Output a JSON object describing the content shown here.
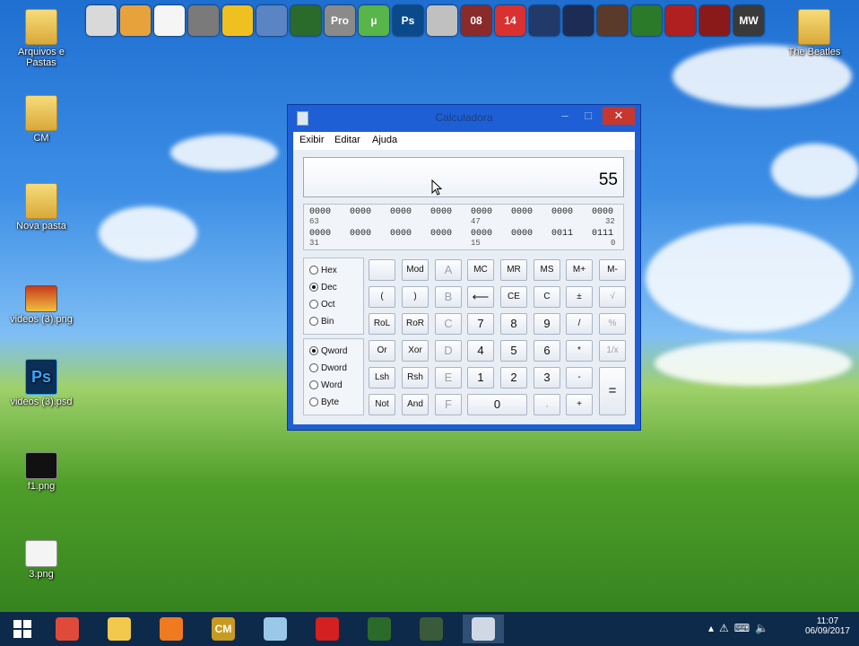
{
  "desktop": {
    "icons": [
      {
        "label": "Arquivos e Pastas"
      },
      {
        "label": "CM"
      },
      {
        "label": "Nova pasta"
      },
      {
        "label": "videos (3).png"
      },
      {
        "label": "videos (3).psd"
      },
      {
        "label": "f1.png"
      },
      {
        "label": "3.png"
      },
      {
        "label": "The Beatles"
      }
    ],
    "top_shortcuts": [
      {
        "text": "",
        "icon": "recycle-bin-icon",
        "color": "#d9d9d9"
      },
      {
        "text": "",
        "icon": "tools-icon",
        "color": "#e8a23c"
      },
      {
        "text": "",
        "icon": "notepad-icon",
        "color": "#f5f5f5"
      },
      {
        "text": "",
        "icon": "joystick-icon",
        "color": "#7a7a7a"
      },
      {
        "text": "",
        "icon": "network-icon",
        "color": "#f0c020"
      },
      {
        "text": "",
        "icon": "virtualbox-icon",
        "color": "#5a84c4"
      },
      {
        "text": "",
        "icon": "3ds-icon",
        "color": "#2a6a2a"
      },
      {
        "text": "Pro",
        "icon": "cd-pro-icon",
        "color": "#8a8a8a"
      },
      {
        "text": "µ",
        "icon": "utorrent-icon",
        "color": "#57b54a"
      },
      {
        "text": "Ps",
        "icon": "photoshop-icon",
        "color": "#0b4a8a"
      },
      {
        "text": "",
        "icon": "gamepad-icon",
        "color": "#c0c0c0"
      },
      {
        "text": "08",
        "icon": "game-08-icon",
        "color": "#8a2a2a"
      },
      {
        "text": "14",
        "icon": "game-14-icon",
        "color": "#d93030"
      },
      {
        "text": "",
        "icon": "pes-icon",
        "color": "#223a6a"
      },
      {
        "text": "",
        "icon": "pes-2-icon",
        "color": "#1c2c54"
      },
      {
        "text": "",
        "icon": "driver-icon",
        "color": "#5a3a2a"
      },
      {
        "text": "",
        "icon": "farming-icon",
        "color": "#2a7a2a"
      },
      {
        "text": "",
        "icon": "q-icon",
        "color": "#b02020"
      },
      {
        "text": "",
        "icon": "game-iii-icon",
        "color": "#8a1a1a"
      },
      {
        "text": "MW",
        "icon": "nfs-mw-icon",
        "color": "#3a3a3a"
      }
    ]
  },
  "calculator": {
    "title": "Calculadora",
    "menu": [
      "Exibir",
      "Editar",
      "Ajuda"
    ],
    "display_value": "55",
    "bits_row1": [
      "0000",
      "0000",
      "0000",
      "0000",
      "0000",
      "0000",
      "0000",
      "0000"
    ],
    "bits_row2": [
      "0000",
      "0000",
      "0000",
      "0000",
      "0000",
      "0000",
      "0011",
      "0111"
    ],
    "bit_indices": [
      "63",
      "47",
      "32",
      "31",
      "15",
      "0"
    ],
    "base_options": [
      "Hex",
      "Dec",
      "Oct",
      "Bin"
    ],
    "base_selected": "Dec",
    "word_options": [
      "Qword",
      "Dword",
      "Word",
      "Byte"
    ],
    "word_selected": "Qword",
    "buttons": {
      "blank": "",
      "mod": "Mod",
      "a": "A",
      "mc": "MC",
      "mr": "MR",
      "ms": "MS",
      "mplus": "M+",
      "mminus": "M-",
      "lparen": "(",
      "rparen": ")",
      "b": "B",
      "back": "⟵",
      "ce": "CE",
      "c": "C",
      "pm": "±",
      "sqrt": "√",
      "rol": "RoL",
      "ror": "RoR",
      "cc": "C",
      "n7": "7",
      "n8": "8",
      "n9": "9",
      "div": "/",
      "pct": "%",
      "or": "Or",
      "xor": "Xor",
      "d": "D",
      "n4": "4",
      "n5": "5",
      "n6": "6",
      "mul": "*",
      "recip": "1/x",
      "lsh": "Lsh",
      "rsh": "Rsh",
      "e": "E",
      "n1": "1",
      "n2": "2",
      "n3": "3",
      "sub": "-",
      "eq": "=",
      "not": "Not",
      "and": "And",
      "f": "F",
      "n0": "0",
      "dot": ",",
      "add": "+"
    }
  },
  "taskbar": {
    "time": "11:07",
    "date": "06/09/2017",
    "apps": [
      {
        "icon": "chrome-icon",
        "text": "",
        "color": "#e04a3a"
      },
      {
        "icon": "file-explorer-icon",
        "text": "",
        "color": "#f2c94c"
      },
      {
        "icon": "media-player-icon",
        "text": "",
        "color": "#f07a20"
      },
      {
        "icon": "cm-app-icon",
        "text": "CM",
        "color": "#c89a20"
      },
      {
        "icon": "notepad-app-icon",
        "text": "",
        "color": "#9ac8e8"
      },
      {
        "icon": "paint-splash-icon",
        "text": "",
        "color": "#d42020"
      },
      {
        "icon": "3ds-app-icon",
        "text": "",
        "color": "#2a6a2a"
      },
      {
        "icon": "3ds-app-2-icon",
        "text": "",
        "color": "#3a5a3a"
      },
      {
        "icon": "calculator-app-icon",
        "text": "",
        "color": "#cfd8e4"
      }
    ]
  }
}
